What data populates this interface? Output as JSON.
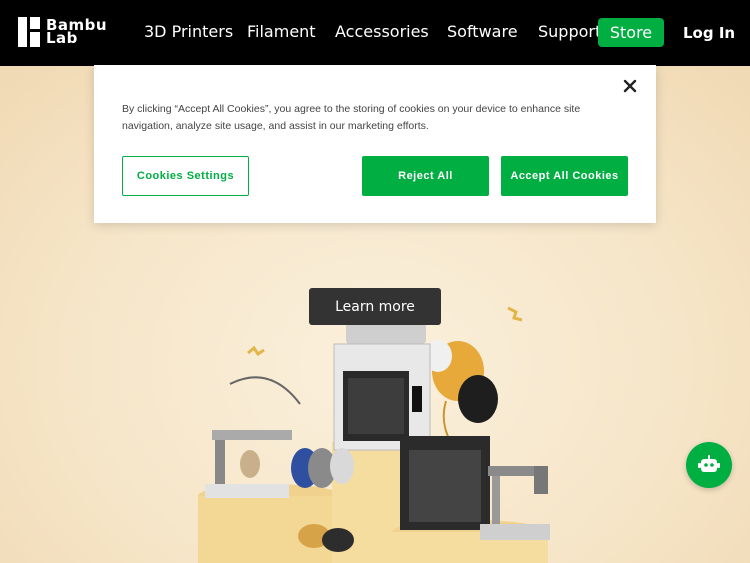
{
  "brand": {
    "line1": "Bambu",
    "line2": "Lab"
  },
  "nav": {
    "items": [
      "3D Printers",
      "Filament",
      "Accessories",
      "Software",
      "Support"
    ],
    "store_label": "Store",
    "login_label": "Log In"
  },
  "hero": {
    "cta_label": "Learn more",
    "illustration": "3d-printers-celebration-illustration"
  },
  "cookie_banner": {
    "text": "By clicking “Accept All Cookies”, you agree to the storing of cookies on your device to enhance site navigation, analyze site usage, and assist in our marketing efforts.",
    "settings_label": "Cookies Settings",
    "reject_label": "Reject All",
    "accept_label": "Accept All Cookies",
    "close_icon": "close-icon"
  },
  "chatbot": {
    "icon": "robot-icon"
  },
  "colors": {
    "accent": "#00ae42",
    "nav_bg": "#000000",
    "hero_bg": "#f6e6c9"
  }
}
